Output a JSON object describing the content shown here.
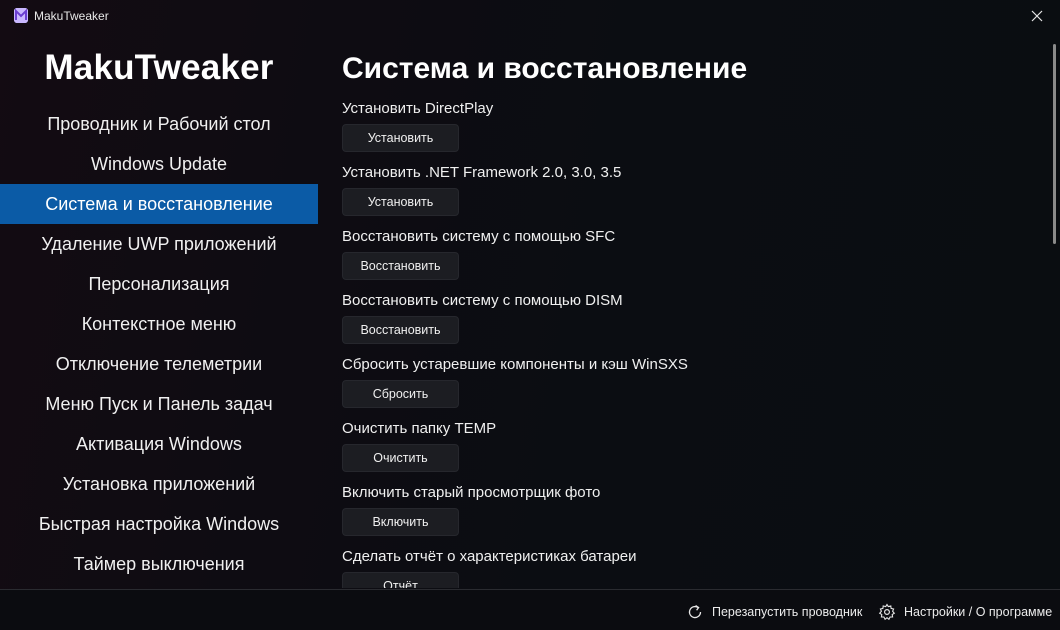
{
  "window": {
    "title": "MakuTweaker",
    "icon": "makutweaker-logo-icon",
    "close_icon": "close-icon"
  },
  "sidebar": {
    "brand": "MakuTweaker",
    "items": [
      {
        "label": "Проводник и Рабочий стол",
        "active": false
      },
      {
        "label": "Windows Update",
        "active": false
      },
      {
        "label": "Система и восстановление",
        "active": true
      },
      {
        "label": "Удаление UWP приложений",
        "active": false
      },
      {
        "label": "Персонализация",
        "active": false
      },
      {
        "label": "Контекстное меню",
        "active": false
      },
      {
        "label": "Отключение телеметрии",
        "active": false
      },
      {
        "label": "Меню Пуск и Панель задач",
        "active": false
      },
      {
        "label": "Активация Windows",
        "active": false
      },
      {
        "label": "Установка приложений",
        "active": false
      },
      {
        "label": "Быстрая настройка Windows",
        "active": false
      },
      {
        "label": "Таймер выключения",
        "active": false
      }
    ],
    "active_color": "#0b5ba6"
  },
  "main": {
    "title": "Система и восстановление",
    "settings": [
      {
        "label": "Установить DirectPlay",
        "button": "Установить"
      },
      {
        "label": "Установить .NET Framework 2.0, 3.0, 3.5",
        "button": "Установить"
      },
      {
        "label": "Восстановить систему с помощью SFC",
        "button": "Восстановить"
      },
      {
        "label": "Восстановить систему с помощью DISM",
        "button": "Восстановить"
      },
      {
        "label": "Сбросить устаревшие компоненты и кэш WinSXS",
        "button": "Сбросить"
      },
      {
        "label": "Очистить папку TEMP",
        "button": "Очистить"
      },
      {
        "label": "Включить старый просмотрщик фото",
        "button": "Включить"
      },
      {
        "label": "Сделать отчёт о характеристиках батареи",
        "button": "Отчёт"
      }
    ]
  },
  "footer": {
    "restart_explorer": "Перезапустить проводник",
    "restart_icon": "restart-icon",
    "settings_about": "Настройки / О программе",
    "settings_icon": "gear-icon"
  }
}
